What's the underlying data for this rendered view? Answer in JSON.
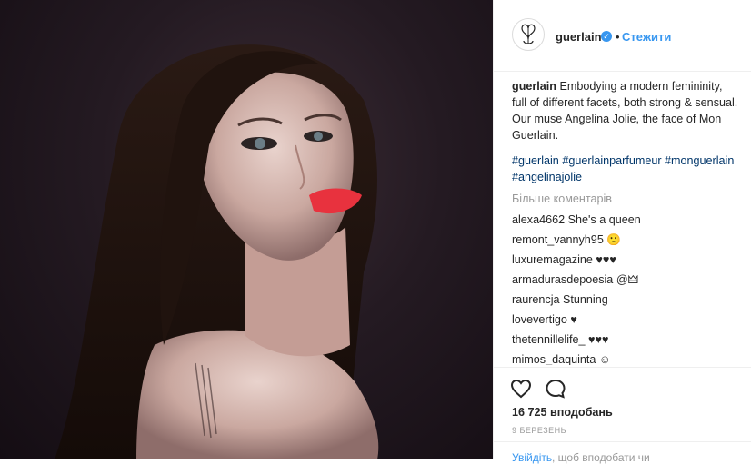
{
  "post": {
    "image_alt": "Portrait photo",
    "account": {
      "username": "guerlain",
      "verified_icon": "verified-check-icon",
      "separator": "•",
      "follow_label": "Стежити"
    },
    "caption": {
      "username": "guerlain",
      "text": "Embodying a modern femininity, full of different facets, both strong & sensual. Our muse Angelina Jolie, the face of Mon Guerlain.",
      "hashtags": "#guerlain #guerlainparfumeur #monguerlain #angelinajolie"
    },
    "more_comments_label": "Більше коментарів",
    "comments": [
      {
        "user": "alexa4662",
        "text": "She's a queen"
      },
      {
        "user": "remont_vannyh95",
        "text": "🙁"
      },
      {
        "user": "luxuremagazine",
        "text": "♥♥♥"
      },
      {
        "user": "armadurasdepoesia",
        "text": "@🜲"
      },
      {
        "user": "raurencja",
        "text": "Stunning"
      },
      {
        "user": "lovevertigo",
        "text": "♥"
      },
      {
        "user": "thetennillelife_",
        "text": "♥♥♥"
      },
      {
        "user": "mimos_daquinta",
        "text": "☺"
      }
    ],
    "likes": "16 725 вподобань",
    "date": "9 БЕРЕЗЕНЬ",
    "login_link": "Увійдіть",
    "login_text": ", щоб вподобати чи"
  },
  "colors": {
    "link": "#3897f0",
    "hashtag": "#003569",
    "muted": "#999999",
    "lips": "#e8323e"
  }
}
